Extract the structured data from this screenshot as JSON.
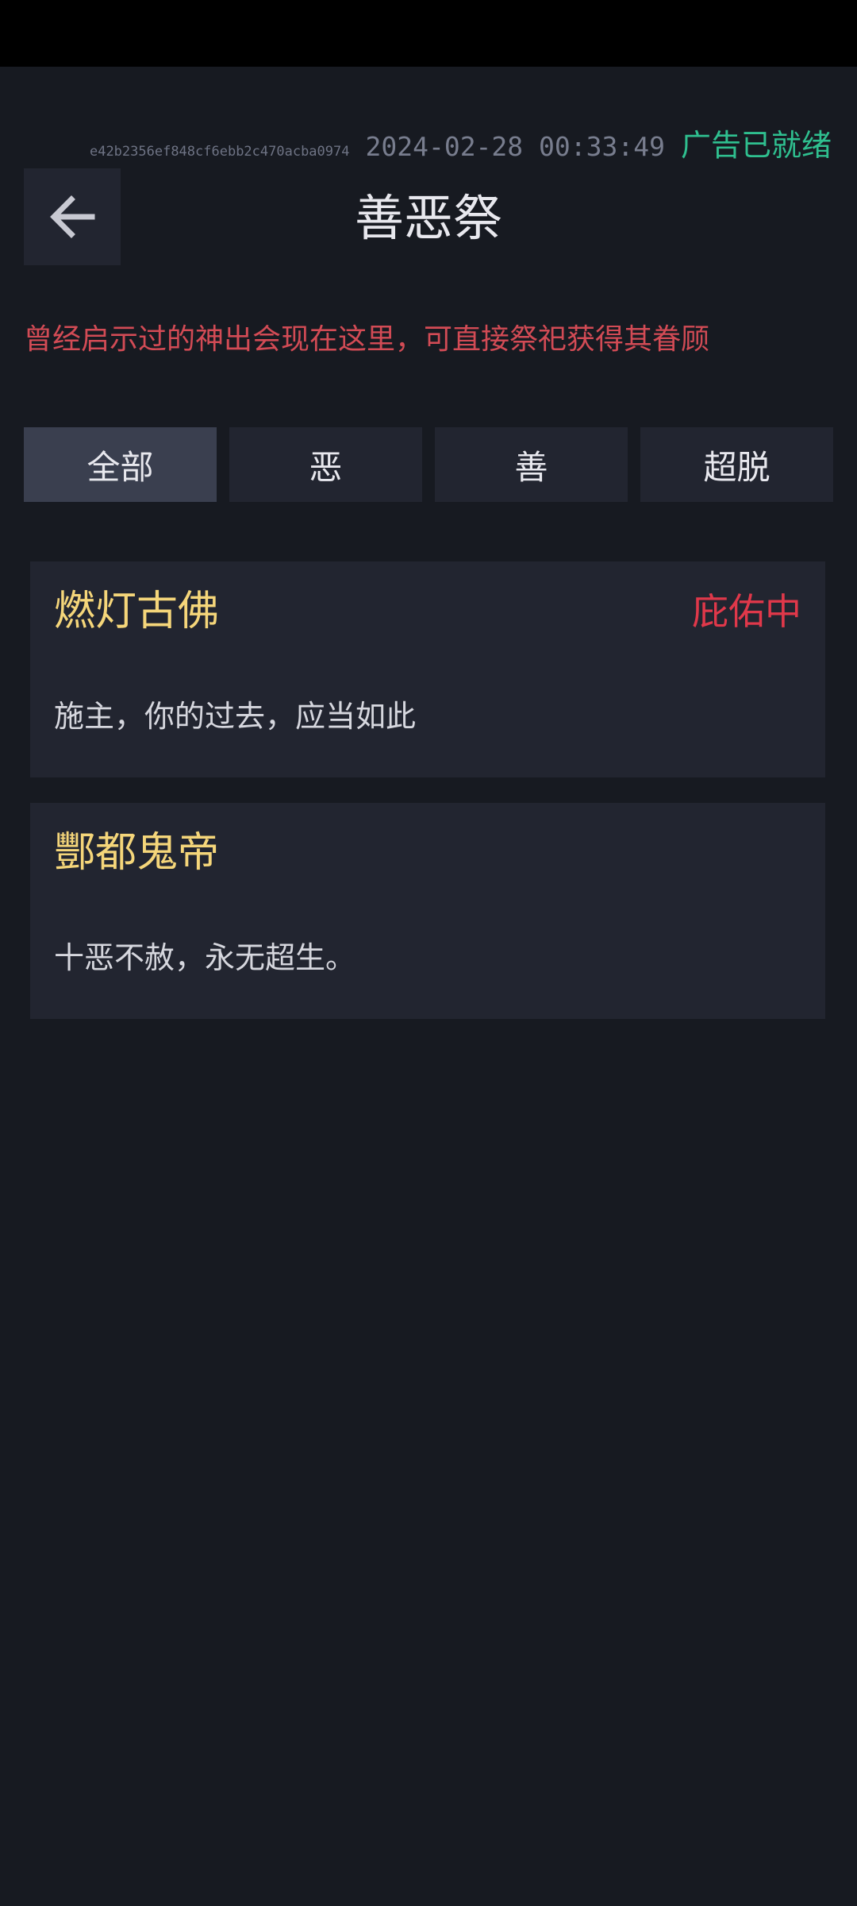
{
  "header": {
    "device_id": "e42b2356ef848cf6ebb2c470acba0974",
    "timestamp": "2024-02-28 00:33:49",
    "ad_status": "广告已就绪",
    "title": "善恶祭"
  },
  "notice": "曾经启示过的神出会现在这里，可直接祭祀获得其眷顾",
  "tabs": [
    {
      "label": "全部",
      "active": true
    },
    {
      "label": "恶",
      "active": false
    },
    {
      "label": "善",
      "active": false
    },
    {
      "label": "超脱",
      "active": false
    }
  ],
  "cards": [
    {
      "name": "燃灯古佛",
      "badge": "庇佑中",
      "desc": "施主，你的过去，应当如此"
    },
    {
      "name": "酆都鬼帝",
      "badge": "",
      "desc": "十恶不赦，永无超生。"
    }
  ],
  "colors": {
    "background": "#171a21",
    "card": "#222530",
    "tab_active": "#3a3f4f",
    "notice_red": "#d24b55",
    "ad_green": "#2fbf8f",
    "name_gold": "#f5d67a",
    "badge_red": "#e0384a"
  },
  "icons": {
    "back": "arrow-left-icon"
  }
}
